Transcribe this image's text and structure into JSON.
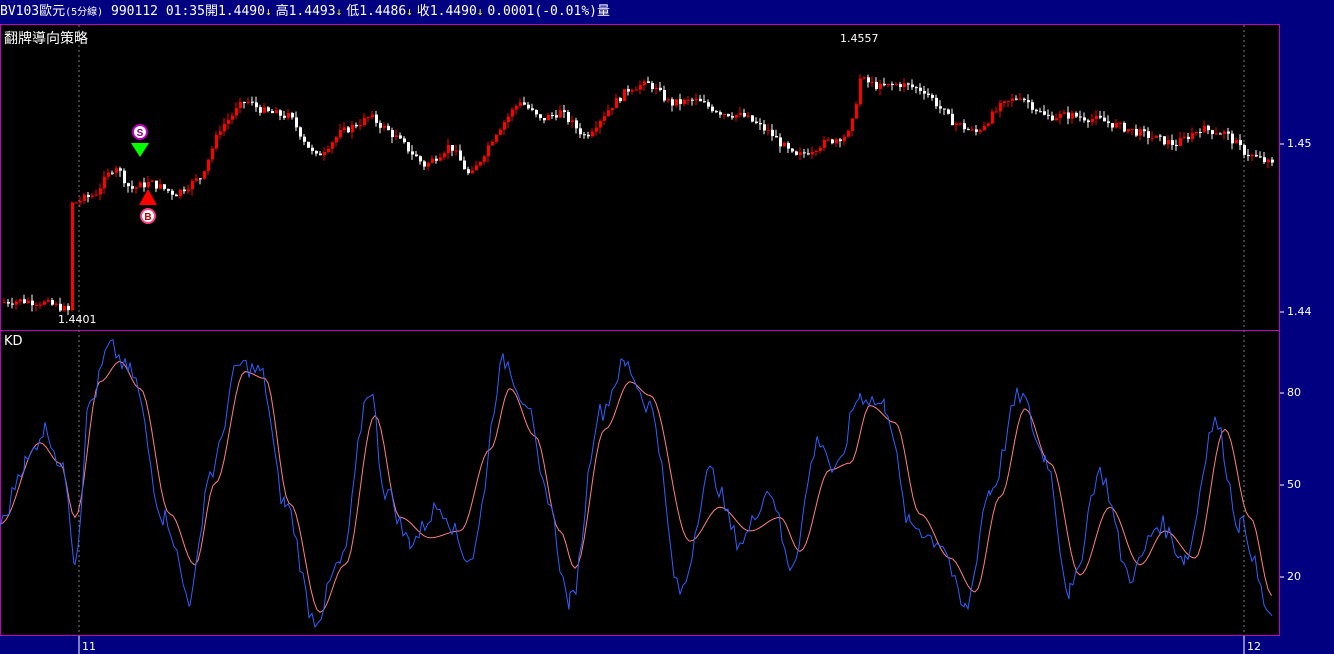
{
  "header": {
    "symbol": "BV103歐元",
    "period": "(5分線)",
    "date": "990112",
    "time": "01:35",
    "open_label": "開",
    "open_value": "1.4490",
    "high_label": "高",
    "high_value": "1.4493",
    "low_label": "低",
    "low_value": "1.4486",
    "close_label": "收",
    "close_value": "1.4490",
    "change": "0.0001(-0.01%)",
    "volume_label": "量"
  },
  "colors": {
    "header_bg": "#000080",
    "panel_bg": "#000000",
    "border": "#c000c0",
    "up_candle": "#ff0000",
    "down_candle": "#ffffff",
    "k_line": "#3060ff",
    "d_line": "#ff8080",
    "sell_marker": "#00ff00",
    "buy_marker": "#ff0000"
  },
  "price_panel": {
    "title": "翻牌導向策略",
    "high_annotation": "1.4557",
    "low_annotation": "1.4401",
    "axis_ticks": [
      "1.45",
      "1.44"
    ],
    "sell_signal_label": "S",
    "buy_signal_label": "B"
  },
  "kd_panel": {
    "title": "KD",
    "axis_ticks": [
      "80",
      "50",
      "20"
    ]
  },
  "time_axis": {
    "labels": [
      "11",
      "12"
    ]
  },
  "chart_data": [
    {
      "type": "candlestick",
      "title": "翻牌導向策略",
      "ylim": [
        1.4392,
        1.4578
      ],
      "yticks": [
        1.45,
        1.44
      ],
      "annotations": [
        {
          "label": "1.4557",
          "value": 1.4557
        },
        {
          "label": "1.4401",
          "value": 1.4401
        }
      ],
      "close_anchors": [
        [
          0,
          1.4409
        ],
        [
          20,
          1.441
        ],
        [
          40,
          1.4409
        ],
        [
          60,
          1.4406
        ],
        [
          70,
          1.4403
        ],
        [
          72,
          1.4469
        ],
        [
          95,
          1.4475
        ],
        [
          115,
          1.4493
        ],
        [
          130,
          1.4478
        ],
        [
          150,
          1.4482
        ],
        [
          175,
          1.4475
        ],
        [
          200,
          1.4485
        ],
        [
          220,
          1.4515
        ],
        [
          245,
          1.4532
        ],
        [
          265,
          1.4525
        ],
        [
          290,
          1.4522
        ],
        [
          315,
          1.4497
        ],
        [
          340,
          1.4512
        ],
        [
          370,
          1.4522
        ],
        [
          395,
          1.451
        ],
        [
          425,
          1.4492
        ],
        [
          450,
          1.4505
        ],
        [
          470,
          1.4485
        ],
        [
          495,
          1.4512
        ],
        [
          520,
          1.4532
        ],
        [
          540,
          1.452
        ],
        [
          560,
          1.4525
        ],
        [
          585,
          1.451
        ],
        [
          610,
          1.4528
        ],
        [
          630,
          1.454
        ],
        [
          650,
          1.4542
        ],
        [
          670,
          1.453
        ],
        [
          695,
          1.4532
        ],
        [
          720,
          1.4525
        ],
        [
          745,
          1.4522
        ],
        [
          770,
          1.4512
        ],
        [
          795,
          1.4497
        ],
        [
          820,
          1.4505
        ],
        [
          850,
          1.4512
        ],
        [
          860,
          1.4545
        ],
        [
          880,
          1.454
        ],
        [
          900,
          1.4542
        ],
        [
          925,
          1.4538
        ],
        [
          950,
          1.452
        ],
        [
          975,
          1.4512
        ],
        [
          1000,
          1.4528
        ],
        [
          1020,
          1.4535
        ],
        [
          1045,
          1.4522
        ],
        [
          1070,
          1.4523
        ],
        [
          1100,
          1.452
        ],
        [
          1125,
          1.4515
        ],
        [
          1150,
          1.451
        ],
        [
          1175,
          1.4505
        ],
        [
          1200,
          1.4515
        ],
        [
          1225,
          1.4512
        ],
        [
          1245,
          1.45
        ],
        [
          1275,
          1.4492
        ]
      ]
    },
    {
      "type": "line",
      "title": "KD",
      "ylim": [
        7,
        97
      ],
      "yticks": [
        80,
        50,
        20
      ],
      "series": [
        {
          "key": "K",
          "x": [
            0,
            25,
            45,
            65,
            75,
            90,
            110,
            130,
            165,
            190,
            210,
            240,
            260,
            285,
            315,
            340,
            370,
            385,
            410,
            440,
            470,
            505,
            525,
            545,
            570,
            600,
            625,
            650,
            680,
            710,
            740,
            770,
            790,
            820,
            835,
            860,
            885,
            910,
            940,
            965,
            990,
            1020,
            1045,
            1070,
            1100,
            1130,
            1160,
            1185,
            1215,
            1240,
            1272
          ],
          "values": [
            40,
            58,
            68,
            55,
            30,
            76,
            92,
            85,
            42,
            18,
            55,
            87,
            85,
            46,
            12,
            28,
            80,
            50,
            35,
            45,
            30,
            88,
            77,
            50,
            17,
            73,
            87,
            75,
            20,
            55,
            35,
            50,
            28,
            65,
            55,
            78,
            75,
            40,
            35,
            15,
            50,
            78,
            60,
            20,
            55,
            25,
            40,
            30,
            70,
            40,
            13
          ]
        },
        {
          "key": "D",
          "x": [
            0,
            40,
            60,
            75,
            100,
            120,
            140,
            170,
            195,
            215,
            245,
            265,
            290,
            320,
            345,
            375,
            400,
            430,
            460,
            490,
            510,
            535,
            560,
            575,
            605,
            630,
            650,
            690,
            720,
            750,
            780,
            800,
            830,
            850,
            870,
            895,
            920,
            950,
            975,
            1000,
            1025,
            1050,
            1080,
            1110,
            1140,
            1165,
            1195,
            1225,
            1250,
            1272
          ],
          "values": [
            40,
            64,
            58,
            42,
            82,
            88,
            80,
            43,
            28,
            52,
            85,
            83,
            46,
            14,
            28,
            72,
            42,
            36,
            38,
            62,
            80,
            66,
            38,
            27,
            68,
            82,
            78,
            35,
            45,
            38,
            42,
            32,
            56,
            58,
            75,
            70,
            43,
            30,
            20,
            48,
            74,
            58,
            25,
            45,
            28,
            38,
            30,
            68,
            42,
            19
          ]
        }
      ]
    }
  ]
}
